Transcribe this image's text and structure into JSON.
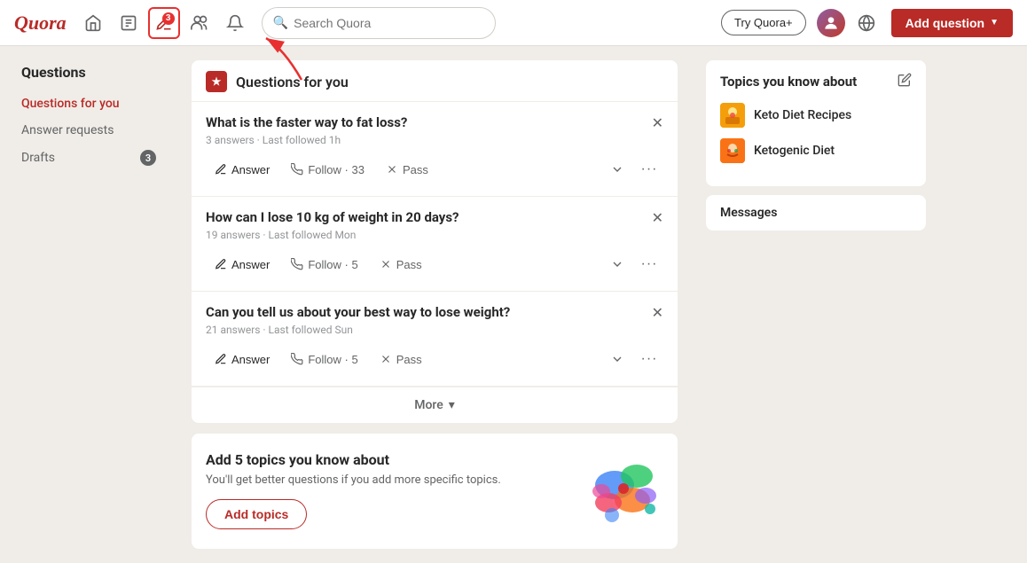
{
  "header": {
    "logo": "Quora",
    "search_placeholder": "Search Quora",
    "try_quora_label": "Try Quora+",
    "add_question_label": "Add question",
    "notification_count": "3"
  },
  "sidebar": {
    "title": "Questions",
    "items": [
      {
        "id": "questions-for-you",
        "label": "Questions for you",
        "active": true,
        "badge": null
      },
      {
        "id": "answer-requests",
        "label": "Answer requests",
        "active": false,
        "badge": null
      },
      {
        "id": "drafts",
        "label": "Drafts",
        "active": false,
        "badge": "3"
      }
    ]
  },
  "feed": {
    "header_icon": "★",
    "header_title": "Questions for you",
    "questions": [
      {
        "id": "q1",
        "title": "What is the faster way to fat loss?",
        "meta": "3 answers · Last followed 1h",
        "answer_label": "Answer",
        "follow_label": "Follow · 33",
        "pass_label": "Pass"
      },
      {
        "id": "q2",
        "title": "How can I lose 10 kg of weight in 20 days?",
        "meta": "19 answers · Last followed Mon",
        "answer_label": "Answer",
        "follow_label": "Follow · 5",
        "pass_label": "Pass"
      },
      {
        "id": "q3",
        "title": "Can you tell us about your best way to lose weight?",
        "meta": "21 answers · Last followed Sun",
        "answer_label": "Answer",
        "follow_label": "Follow · 5",
        "pass_label": "Pass"
      }
    ],
    "more_label": "More"
  },
  "add_topics": {
    "title": "Add 5 topics you know about",
    "description": "You'll get better questions if you add more specific topics.",
    "button_label": "Add topics"
  },
  "right_sidebar": {
    "topics_title": "Topics you know about",
    "topics": [
      {
        "id": "keto-diet",
        "name": "Keto Diet Recipes"
      },
      {
        "id": "ketogenic",
        "name": "Ketogenic Diet"
      }
    ],
    "messages_label": "Messages"
  }
}
